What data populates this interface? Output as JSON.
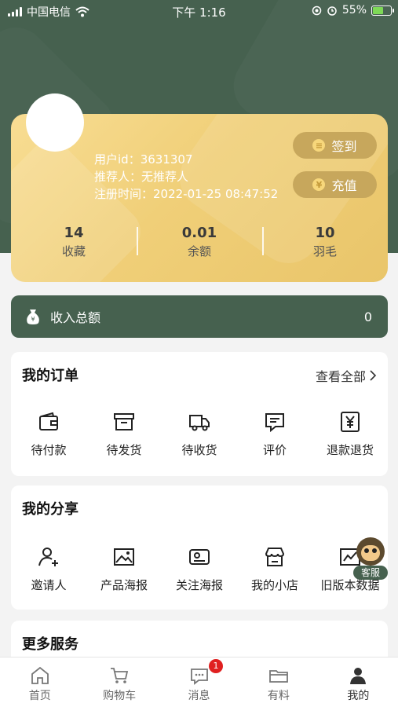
{
  "status_bar": {
    "carrier": "中国电信",
    "time": "下午 1:16",
    "battery_percent": "55%",
    "battery_level": 0.55
  },
  "profile": {
    "user_id": "用户id：3631307",
    "referrer": "推荐人：无推荐人",
    "register_time": "注册时间：2022-01-25 08:47:52",
    "sign_in_label": "签到",
    "recharge_label": "充值",
    "stats": [
      {
        "value": "14",
        "label": "收藏"
      },
      {
        "value": "0.01",
        "label": "余额"
      },
      {
        "value": "10",
        "label": "羽毛"
      }
    ]
  },
  "income": {
    "label": "收入总额",
    "value": "0"
  },
  "orders": {
    "title": "我的订单",
    "view_all": "查看全部",
    "items": [
      {
        "label": "待付款",
        "icon": "wallet-icon"
      },
      {
        "label": "待发货",
        "icon": "box-icon"
      },
      {
        "label": "待收货",
        "icon": "truck-icon"
      },
      {
        "label": "评价",
        "icon": "comment-icon"
      },
      {
        "label": "退款退货",
        "icon": "refund-icon"
      }
    ]
  },
  "share": {
    "title": "我的分享",
    "items": [
      {
        "label": "邀请人",
        "icon": "add-user-icon"
      },
      {
        "label": "产品海报",
        "icon": "image-icon"
      },
      {
        "label": "关注海报",
        "icon": "follow-poster-icon"
      },
      {
        "label": "我的小店",
        "icon": "shop-icon"
      },
      {
        "label": "旧版本数据",
        "icon": "chart-icon"
      }
    ]
  },
  "more": {
    "title": "更多服务"
  },
  "customer_service": {
    "label": "客服"
  },
  "tabbar": {
    "items": [
      {
        "label": "首页",
        "icon": "home-icon"
      },
      {
        "label": "购物车",
        "icon": "cart-icon"
      },
      {
        "label": "消息",
        "icon": "message-icon"
      },
      {
        "label": "有料",
        "icon": "folder-icon"
      },
      {
        "label": "我的",
        "icon": "user-icon"
      }
    ],
    "message_badge": "1"
  },
  "colors": {
    "primary": "#46614f",
    "card_gold": "#f0cf78",
    "badge_red": "#e02020"
  }
}
